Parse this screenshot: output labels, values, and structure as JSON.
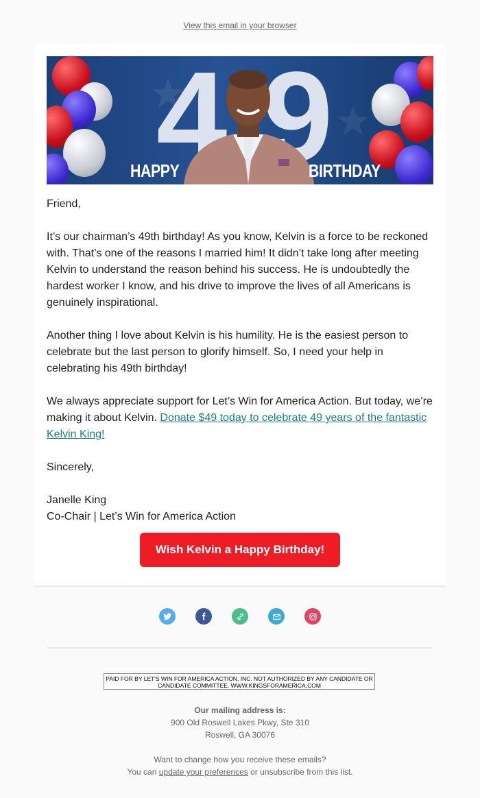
{
  "header": {
    "view_in_browser": "View this email in your browser"
  },
  "banner": {
    "num_left": "4",
    "num_right": "9",
    "word_left": "HAPPY",
    "word_right": "BIRTHDAY"
  },
  "letter": {
    "greeting": "Friend,",
    "p1": "It’s our chairman’s 49th birthday! As you know, Kelvin is a force to be reckoned with. That’s one of the reasons I married him! It didn’t take long after meeting Kelvin to understand the reason behind his success. He is undoubtedly the hardest worker I know, and his drive to improve the lives of all Americans is genuinely inspirational.",
    "p2": "Another thing I love about Kelvin is his humility. He is the easiest person to celebrate but the last person to glorify himself. So, I need your help in celebrating his 49th birthday!",
    "p3_text": "We always appreciate support for Let’s Win for America Action. But today, we’re making it about Kelvin. ",
    "p3_link": "Donate $49 today to celebrate 49 years of the fantastic Kelvin King!",
    "closing": "Sincerely,",
    "signer_name": "Janelle King",
    "signer_title": "Co-Chair | Let’s Win for America Action"
  },
  "cta": {
    "label": "Wish Kelvin a Happy Birthday!"
  },
  "social": {
    "icons": [
      "twitter-icon",
      "facebook-icon",
      "link-icon",
      "email-icon",
      "instagram-icon"
    ],
    "colors": {
      "twitter": "#55acee",
      "facebook": "#3b5998",
      "link": "#4bbd8e",
      "email": "#3ea9d2",
      "instagram": "#dd4560"
    }
  },
  "footer": {
    "disclaimer": "PAID FOR BY LET'S WIN FOR AMERICA ACTION, INC. NOT AUTHORIZED BY ANY CANDIDATE OR CANDIDATE COMMITTEE. WWW.KINGSFORAMERICA.COM",
    "mailing_heading": "Our mailing address is:",
    "address_line1": "900 Old Roswell Lakes Pkwy, Ste 310",
    "address_line2": "Roswell, GA 30076",
    "change_prompt": "Want to change how you receive these emails?",
    "prefs_prefix": "You can ",
    "prefs_link": "update your preferences",
    "prefs_suffix": " or unsubscribe from this list."
  },
  "colors": {
    "page_bg": "#fafafa",
    "cta_bg": "#ee1c25",
    "link": "#1a7c88",
    "banner_blue": "#24508f"
  }
}
